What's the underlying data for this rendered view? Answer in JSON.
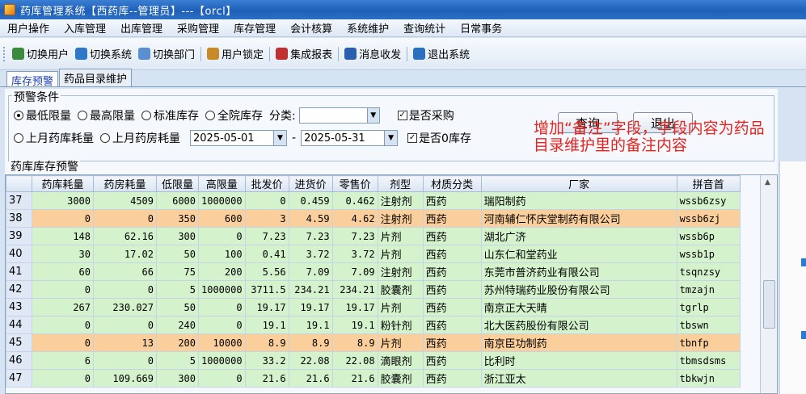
{
  "window": {
    "title": "药库管理系统【西药库--管理员】---【orcl】"
  },
  "menu": [
    "用户操作",
    "入库管理",
    "出库管理",
    "采购管理",
    "库存管理",
    "会计核算",
    "系统维护",
    "查询统计",
    "日常事务"
  ],
  "toolbar": [
    {
      "label": "切换用户",
      "icon": "users-icon",
      "color": "#3c8a3c"
    },
    {
      "label": "切换系统",
      "icon": "switch-system-icon",
      "color": "#2f78c8"
    },
    {
      "label": "切换部门",
      "icon": "department-icon",
      "color": "#5a8fd0"
    },
    {
      "label": "用户锁定",
      "icon": "user-lock-icon",
      "color": "#c88a28"
    },
    {
      "label": "集成报表",
      "icon": "report-icon",
      "color": "#c03030"
    },
    {
      "label": "消息收发",
      "icon": "message-icon",
      "color": "#2a5fb0"
    },
    {
      "label": "退出系统",
      "icon": "exit-icon",
      "color": "#2a70c0"
    }
  ],
  "tabs": [
    "库存预警",
    "药品目录维护"
  ],
  "filters": {
    "legend": "预警条件",
    "radios": [
      "最低限量",
      "最高限量",
      "标准库存",
      "全院库存"
    ],
    "category_label": "分类:",
    "category_value": "",
    "purchase_label": "是否采购",
    "zero_stock_label": "是否0库存",
    "usage_radios": [
      "上月药库耗量",
      "上月药房耗量"
    ],
    "date_from": "2025-05-01",
    "date_sep": "-",
    "date_to": "2025-05-31",
    "query_button": "查询",
    "exit_button": "退出"
  },
  "annotation": "增加“备注”字段，字段内容为药品目录维护里的备注内容",
  "grid": {
    "title": "药库库存预警",
    "columns": [
      "",
      "药库耗量",
      "药房耗量",
      "低限量",
      "高限量",
      "批发价",
      "进货价",
      "零售价",
      "剂型",
      "材质分类",
      "厂家",
      "拼音首"
    ],
    "rows": [
      {
        "n": "37",
        "c": [
          "3000",
          "4509",
          "6000",
          "1000000",
          "0",
          "0.459",
          "0.462",
          "注射剂",
          "西药",
          "瑞阳制药",
          "wssb6zsy"
        ],
        "style": "green"
      },
      {
        "n": "38",
        "c": [
          "0",
          "0",
          "350",
          "600",
          "3",
          "4.59",
          "4.62",
          "注射剂",
          "西药",
          "河南辅仁怀庆堂制药有限公司",
          "wssb6zj"
        ],
        "style": "orange"
      },
      {
        "n": "39",
        "c": [
          "148",
          "62.16",
          "300",
          "0",
          "7.23",
          "7.23",
          "7.23",
          "片剂",
          "西药",
          "湖北广济",
          "wssb6p"
        ],
        "style": "green"
      },
      {
        "n": "40",
        "c": [
          "30",
          "17.02",
          "50",
          "100",
          "0.41",
          "3.72",
          "3.72",
          "片剂",
          "西药",
          "山东仁和堂药业",
          "wssb1p"
        ],
        "style": "green"
      },
      {
        "n": "41",
        "c": [
          "60",
          "66",
          "75",
          "200",
          "5.56",
          "7.09",
          "7.09",
          "注射剂",
          "西药",
          "东莞市普济药业有限公司",
          "tsqnzsy"
        ],
        "style": "green"
      },
      {
        "n": "42",
        "c": [
          "0",
          "0",
          "5",
          "1000000",
          "3711.5",
          "234.21",
          "234.21",
          "胶囊剂",
          "西药",
          "苏州特瑞药业股份有限公司",
          "tmzajn"
        ],
        "style": "green"
      },
      {
        "n": "43",
        "c": [
          "267",
          "230.027",
          "50",
          "0",
          "19.17",
          "19.17",
          "19.17",
          "片剂",
          "西药",
          "南京正大天晴",
          "tgrlp"
        ],
        "style": "green"
      },
      {
        "n": "44",
        "c": [
          "0",
          "0",
          "240",
          "0",
          "19.1",
          "19.1",
          "19.1",
          "粉针剂",
          "西药",
          "北大医药股份有限公司",
          "tbswn"
        ],
        "style": "green"
      },
      {
        "n": "45",
        "c": [
          "0",
          "13",
          "200",
          "10000",
          "8.9",
          "8.9",
          "8.9",
          "片剂",
          "西药",
          "南京臣功制药",
          "tbnfp"
        ],
        "style": "orange"
      },
      {
        "n": "46",
        "c": [
          "6",
          "0",
          "5",
          "1000000",
          "33.2",
          "22.08",
          "22.08",
          "滴眼剂",
          "西药",
          "比利时",
          "tbmsdsms"
        ],
        "style": "green"
      },
      {
        "n": "47",
        "c": [
          "0",
          "109.669",
          "300",
          "0",
          "21.6",
          "21.6",
          "21.6",
          "胶囊剂",
          "西药",
          "浙江亚太",
          "tbkwjn"
        ],
        "style": "green"
      }
    ]
  }
}
